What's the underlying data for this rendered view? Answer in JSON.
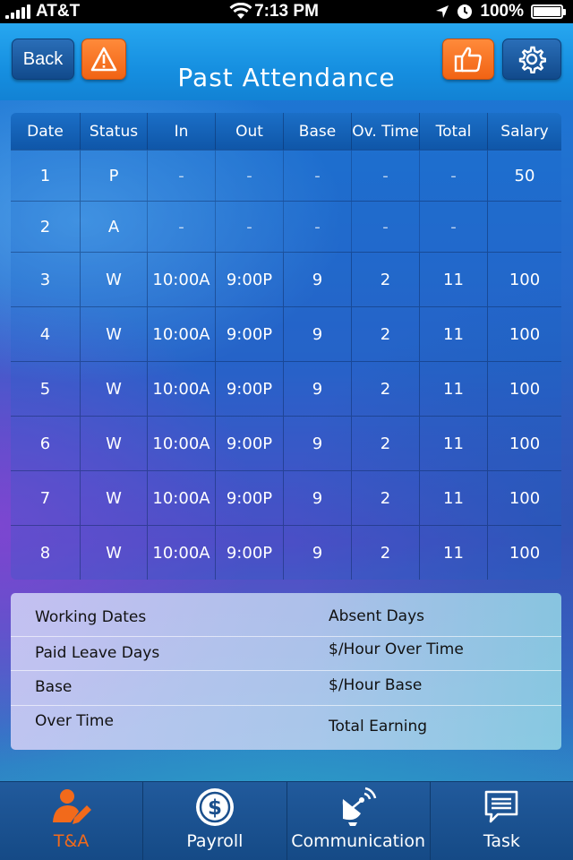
{
  "status_bar": {
    "carrier": "AT&T",
    "time": "7:13 PM",
    "battery": "100%"
  },
  "header": {
    "back_label": "Back",
    "title": "Past Attendance"
  },
  "table": {
    "columns": [
      "Date",
      "Status",
      "In",
      "Out",
      "Base",
      "Ov. Time",
      "Total",
      "Salary"
    ],
    "rows": [
      [
        "1",
        "P",
        "-",
        "-",
        "-",
        "-",
        "-",
        "50"
      ],
      [
        "2",
        "A",
        "-",
        "-",
        "-",
        "-",
        "-",
        ""
      ],
      [
        "3",
        "W",
        "10:00A",
        "9:00P",
        "9",
        "2",
        "11",
        "100"
      ],
      [
        "4",
        "W",
        "10:00A",
        "9:00P",
        "9",
        "2",
        "11",
        "100"
      ],
      [
        "5",
        "W",
        "10:00A",
        "9:00P",
        "9",
        "2",
        "11",
        "100"
      ],
      [
        "6",
        "W",
        "10:00A",
        "9:00P",
        "9",
        "2",
        "11",
        "100"
      ],
      [
        "7",
        "W",
        "10:00A",
        "9:00P",
        "9",
        "2",
        "11",
        "100"
      ],
      [
        "8",
        "W",
        "10:00A",
        "9:00P",
        "9",
        "2",
        "11",
        "100"
      ]
    ]
  },
  "summary": {
    "working_dates": "Working Dates",
    "absent_days": "Absent Days",
    "paid_leave_days": "Paid Leave Days",
    "hour_over_time": "$/Hour Over Time",
    "base": "Base",
    "hour_base": "$/Hour Base",
    "over_time": "Over Time",
    "total_earning": "Total Earning"
  },
  "tabs": [
    {
      "label": "T&A",
      "icon": "person-pencil-icon",
      "active": true
    },
    {
      "label": "Payroll",
      "icon": "dollar-icon",
      "active": false
    },
    {
      "label": "Communication",
      "icon": "satellite-dish-icon",
      "active": false
    },
    {
      "label": "Task",
      "icon": "chat-bubble-icon",
      "active": false
    }
  ],
  "colors": {
    "accent_orange": "#f26a1b",
    "header_blue": "#1f96e8",
    "button_blue": "#1a5ca4"
  }
}
